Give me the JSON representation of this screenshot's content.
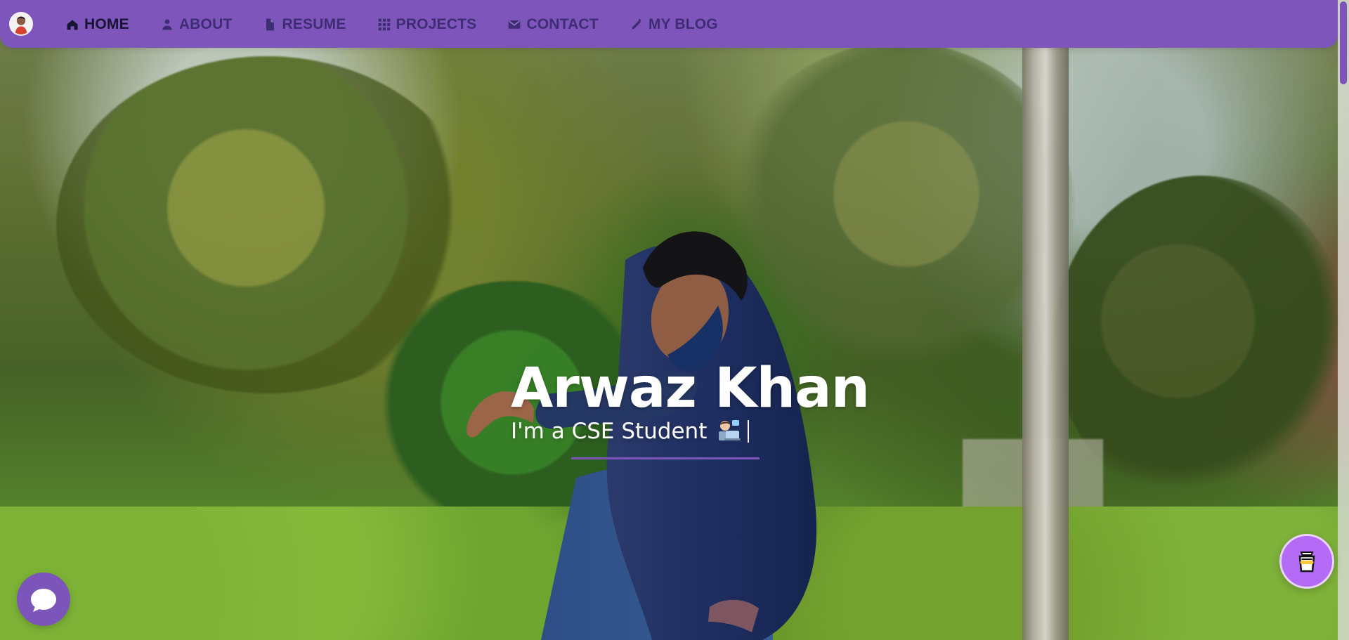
{
  "nav": {
    "items": [
      {
        "label": "HOME",
        "icon": "home-icon",
        "active": true
      },
      {
        "label": "ABOUT",
        "icon": "user-icon",
        "active": false
      },
      {
        "label": "RESUME",
        "icon": "file-icon",
        "active": false
      },
      {
        "label": "PROJECTS",
        "icon": "grid-icon",
        "active": false
      },
      {
        "label": "CONTACT",
        "icon": "mail-icon",
        "active": false
      },
      {
        "label": "MY BLOG",
        "icon": "pencil-icon",
        "active": false
      }
    ],
    "accent": "#7d55bb",
    "text_color": "#3f2d74",
    "active_text_color": "#171431"
  },
  "hero": {
    "name": "Arwaz Khan",
    "subtitle": "I'm a CSE Student",
    "subtitle_emoji": "laptop-technologist-icon",
    "underline_color": "#7d55bb"
  },
  "widgets": {
    "chat_icon": "chat-bubble-icon",
    "coffee_icon": "coffee-cup-icon",
    "chat_color": "#7c55bb",
    "coffee_color": "#b36af4"
  }
}
